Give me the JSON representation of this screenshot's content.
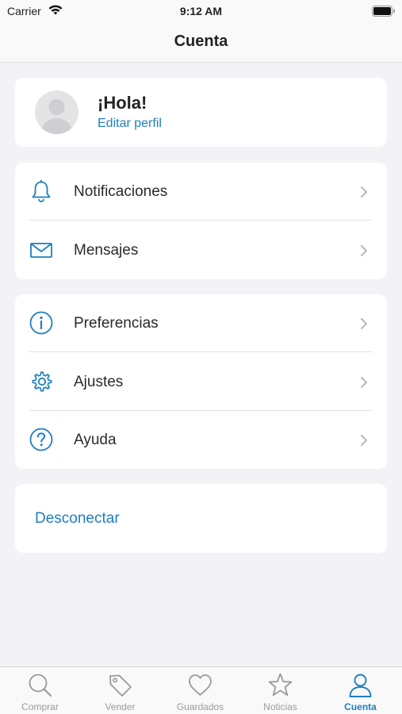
{
  "status_bar": {
    "carrier": "Carrier",
    "time": "9:12 AM"
  },
  "nav": {
    "title": "Cuenta"
  },
  "profile": {
    "greeting": "¡Hola!",
    "edit_link": "Editar perfil"
  },
  "group_1": [
    {
      "label": "Notificaciones",
      "icon": "bell-icon"
    },
    {
      "label": "Mensajes",
      "icon": "envelope-icon"
    }
  ],
  "group_2": [
    {
      "label": "Preferencias",
      "icon": "info-icon"
    },
    {
      "label": "Ajustes",
      "icon": "gear-icon"
    },
    {
      "label": "Ayuda",
      "icon": "question-icon"
    }
  ],
  "logout": "Desconectar",
  "tabs": [
    {
      "label": "Comprar",
      "icon": "search-icon",
      "active": false
    },
    {
      "label": "Vender",
      "icon": "tag-icon",
      "active": false
    },
    {
      "label": "Guardados",
      "icon": "heart-icon",
      "active": false
    },
    {
      "label": "Noticias",
      "icon": "star-icon",
      "active": false
    },
    {
      "label": "Cuenta",
      "icon": "user-icon",
      "active": true
    }
  ],
  "colors": {
    "accent": "#1d7fc0",
    "inactive": "#9a9a9e",
    "background": "#f2f2f7"
  }
}
